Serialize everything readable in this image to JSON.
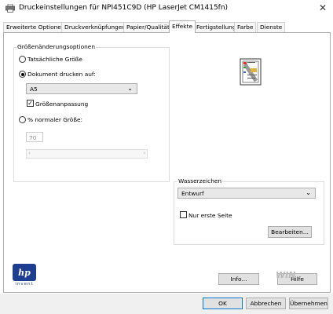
{
  "window": {
    "title": "Druckeinstellungen für NPI451C9D (HP LaserJet CM1415fn)",
    "close": "✕"
  },
  "tabs": [
    {
      "label": "Erweiterte Optionen"
    },
    {
      "label": "Druckverknüpfungen"
    },
    {
      "label": "Papier/Qualität"
    },
    {
      "label": "Effekte"
    },
    {
      "label": "Fertigstellung"
    },
    {
      "label": "Farbe"
    },
    {
      "label": "Dienste"
    }
  ],
  "active_tab": "Effekte",
  "resize": {
    "group_label": "Größenänderungsoptionen",
    "actual_size": "Tatsächliche Größe",
    "print_on": "Dokument drucken auf:",
    "paper_value": "A5",
    "fit_to_page": "Größenanpassung",
    "percent_label": "% normaler Größe:",
    "percent_value": "70",
    "selected_option": "print_on",
    "fit_checked": true
  },
  "watermark": {
    "group_label": "Wasserzeichen",
    "value": "Entwurf",
    "first_page_only": "Nur erste Seite",
    "first_page_checked": false,
    "edit_button": "Bearbeiten..."
  },
  "actions": {
    "info": "Info...",
    "help": "Hilfe",
    "ok": "OK",
    "cancel": "Abbrechen",
    "apply": "Übernehmen"
  },
  "logo": {
    "brand": "hp",
    "tagline": "invent"
  },
  "overlay_watermark": "WIN"
}
